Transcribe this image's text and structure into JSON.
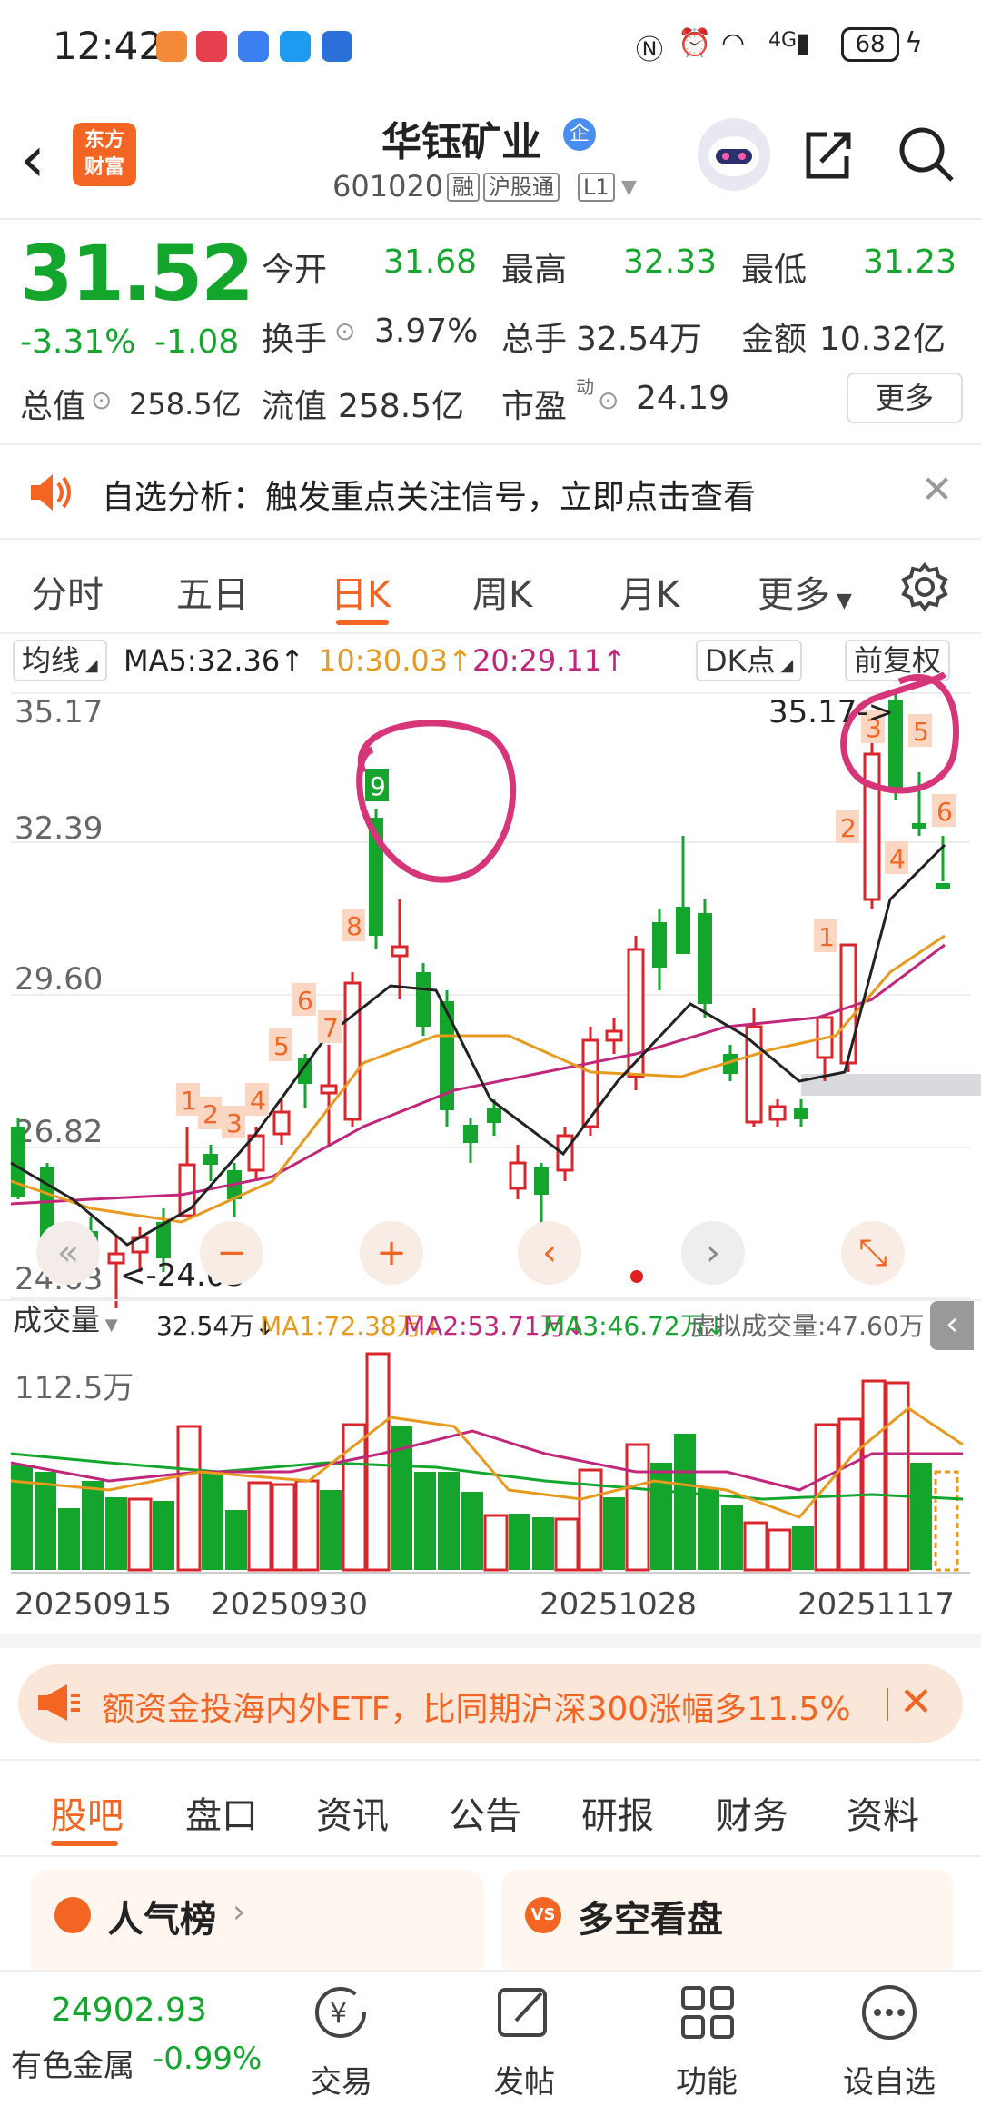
{
  "status_bar": {
    "time": "12:42",
    "battery": "68",
    "network": "4G"
  },
  "header": {
    "title": "华钰矿业",
    "enterprise_badge": "企",
    "code": "601020",
    "tags": [
      "融",
      "沪股通",
      "L1"
    ],
    "logo_line1": "东方",
    "logo_line2": "财富"
  },
  "quote": {
    "price": "31.52",
    "change_pct": "-3.31%",
    "change_abs": "-1.08",
    "fields": [
      {
        "label": "今开",
        "value": "31.68"
      },
      {
        "label": "最高",
        "value": "32.33"
      },
      {
        "label": "最低",
        "value": "31.23"
      },
      {
        "label": "换手",
        "value": "3.97%"
      },
      {
        "label": "总手",
        "value": "32.54万"
      },
      {
        "label": "金额",
        "value": "10.32亿"
      },
      {
        "label": "总值",
        "value": "258.5亿"
      },
      {
        "label": "流值",
        "value": "258.5亿"
      },
      {
        "label": "市盈",
        "value": "24.19",
        "sup": "动"
      }
    ],
    "more": "更多"
  },
  "notice": {
    "text": "自选分析：触发重点关注信号，立即点击查看"
  },
  "tabs": [
    "分时",
    "五日",
    "日K",
    "周K",
    "月K",
    "更多"
  ],
  "active_tab": "日K",
  "ma": {
    "label": "均线",
    "ma5": "MA5:32.36↑",
    "ma10": "10:30.03↑",
    "ma20": "20:29.11↑",
    "dk": "DK点",
    "adjust": "前复权"
  },
  "kline": {
    "y_labels": [
      "35.17",
      "32.39",
      "29.60",
      "26.82",
      "24.03"
    ],
    "max_note": "35.17->",
    "min_note": "<-24.03",
    "number_marks": [
      "1",
      "2",
      "3",
      "4",
      "5",
      "6",
      "7",
      "8",
      "9",
      "1",
      "2",
      "3",
      "4",
      "5",
      "6"
    ]
  },
  "volume": {
    "label": "成交量",
    "value": "32.54万↓",
    "ma1": "MA1:72.38万↓",
    "ma2": "MA2:53.71万↓",
    "ma3": "MA3:46.72万↓",
    "virtual": "虚拟成交量:47.60万",
    "y_top": "112.5万"
  },
  "dates": [
    "20250915",
    "20250930",
    "20251028",
    "20251117"
  ],
  "banner": {
    "text": "额资金投海内外ETF，比同期沪深300涨幅多11.5%"
  },
  "bottom_tabs": [
    "股吧",
    "盘口",
    "资讯",
    "公告",
    "研报",
    "财务",
    "资料"
  ],
  "active_bottom_tab": "股吧",
  "cards": [
    {
      "title": "人气榜"
    },
    {
      "title": "多空看盘"
    }
  ],
  "bottom_nav": {
    "index_value": "24902.93",
    "index_name": "有色金属",
    "index_change": "-0.99%",
    "items": [
      {
        "label": "交易"
      },
      {
        "label": "发帖"
      },
      {
        "label": "功能"
      },
      {
        "label": "设自选"
      }
    ]
  },
  "colors": {
    "up": "#d8262c",
    "down": "#14a52d",
    "accent": "#f26522",
    "annotation": "#d6357a"
  }
}
